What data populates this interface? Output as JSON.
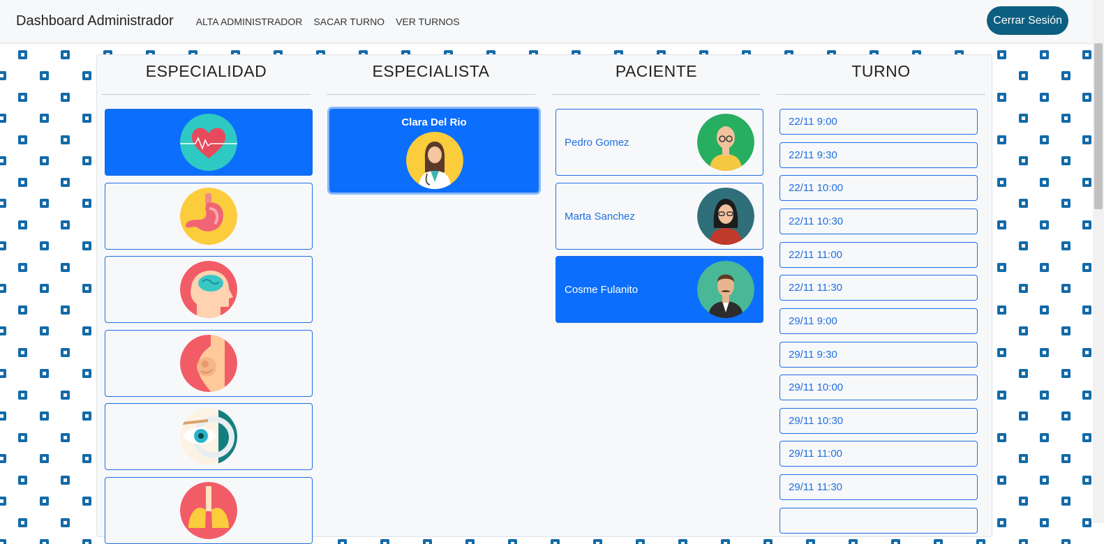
{
  "navbar": {
    "brand": "Dashboard Administrador",
    "links": [
      "ALTA ADMINISTRADOR",
      "SACAR TURNO",
      "VER TURNOS"
    ],
    "logout_label": "Cerrar Sesión"
  },
  "columns": {
    "especialidad": "ESPECIALIDAD",
    "especialista": "ESPECIALISTA",
    "paciente": "PACIENTE",
    "turno": "TURNO"
  },
  "especialidades": [
    {
      "icon": "heart-icon",
      "selected": true
    },
    {
      "icon": "stomach-icon",
      "selected": false
    },
    {
      "icon": "brain-icon",
      "selected": false
    },
    {
      "icon": "pregnancy-icon",
      "selected": false
    },
    {
      "icon": "eye-icon",
      "selected": false
    },
    {
      "icon": "lungs-icon",
      "selected": false
    }
  ],
  "especialistas": [
    {
      "name": "Clara Del Rio",
      "icon": "doctor-avatar-icon",
      "selected": true
    }
  ],
  "pacientes": [
    {
      "name": "Pedro Gomez",
      "icon": "bald-man-avatar-icon",
      "selected": false
    },
    {
      "name": "Marta Sanchez",
      "icon": "woman-glasses-avatar-icon",
      "selected": false
    },
    {
      "name": "Cosme Fulanito",
      "icon": "man-mustache-avatar-icon",
      "selected": true
    }
  ],
  "turnos": [
    "22/11 9:00",
    "22/11 9:30",
    "22/11 10:00",
    "22/11 10:30",
    "22/11 11:00",
    "22/11 11:30",
    "29/11 9:00",
    "29/11 9:30",
    "29/11 10:00",
    "29/11 10:30",
    "29/11 11:00",
    "29/11 11:30",
    ""
  ],
  "colors": {
    "primary": "#0b6efd",
    "navbar_button": "#0c5f80",
    "pattern": "#136aa8"
  }
}
